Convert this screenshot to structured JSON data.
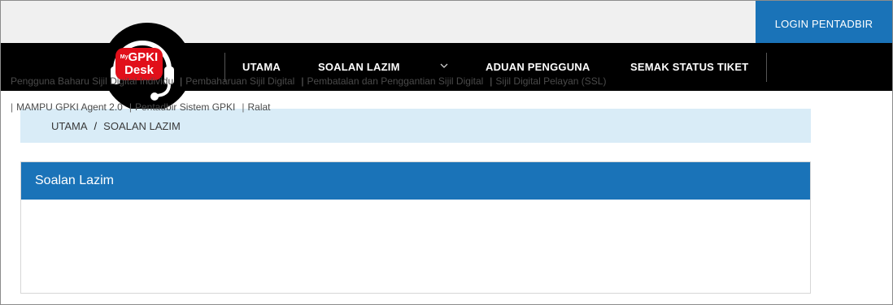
{
  "header": {
    "login_label": "LOGIN PENTADBIR"
  },
  "logo": {
    "prefix": "My",
    "line1": "GPKI",
    "line2": "Desk",
    "icon": "headset-icon",
    "brand_color": "#e10f1a"
  },
  "nav": {
    "items": [
      {
        "label": "UTAMA"
      },
      {
        "label": "SOALAN LAZIM"
      },
      {
        "label": "ADUAN PENGGUNA"
      },
      {
        "label": "SEMAK STATUS TIKET"
      }
    ],
    "dropdown_icon": "chevron-down-icon"
  },
  "breadcrumb": {
    "home": "UTAMA",
    "separator": "/",
    "current": "SOALAN LAZIM"
  },
  "panel": {
    "title": "Soalan Lazim",
    "links": [
      "Pengguna Baharu Sijil Digital Individu",
      "Pembaharuan Sijil Digital",
      "Pembatalan dan Penggantian Sijil Digital",
      "Sijil Digital Pelayan (SSL)",
      "MAMPU GPKI Agent 2.0",
      "Pentadbir Sistem GPKI",
      "Ralat"
    ],
    "separator": "|"
  },
  "colors": {
    "accent": "#1a73b8",
    "breadcrumb_bg": "#d9ecf7",
    "nav_bg": "#000000"
  }
}
